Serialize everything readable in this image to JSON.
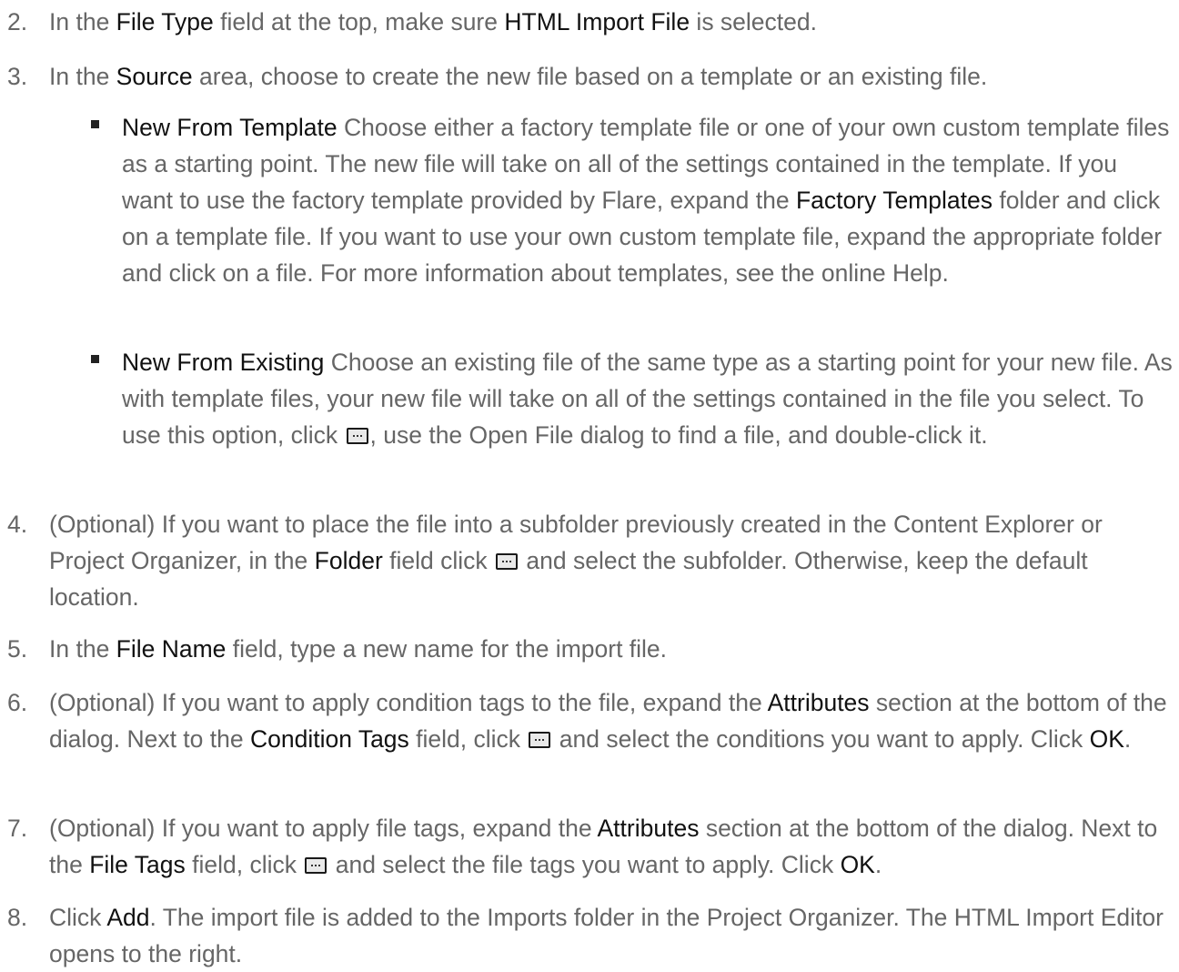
{
  "steps": {
    "s2": {
      "num": "2.",
      "t1": "In the ",
      "k1": "File Type",
      "t2": " field at the top, make sure ",
      "k2": "HTML Import File",
      "t3": " is selected."
    },
    "s3": {
      "num": "3.",
      "t1": "In the ",
      "k1": "Source",
      "t2": " area, choose to create the new file based on a template or an existing file."
    },
    "b1": {
      "k1": "New From Template",
      "t1": " Choose either a factory template file or one of your own custom template files as a starting point. The new file will take on all of the settings contained in the template. If you want to use the factory template provided by Flare, expand the ",
      "k2": "Factory Templates",
      "t2": " folder and click on a template file. If you want to use your own custom template file, expand the appropriate folder and click on a file. For more information about templates, see the online Help."
    },
    "b2": {
      "k1": "New From Existing",
      "t1": " Choose an existing file of the same type as a starting point for your new file. As with template files, your new file will take on all of the settings contained in the file you select. To use this option, click ",
      "t2": ", use the Open File dialog to find a file, and double-click it."
    },
    "s4": {
      "num": "4.",
      "t1": "(Optional) If you want to place the file into a subfolder previously created in the Content Explorer or Project Organizer, in the ",
      "k1": "Folder",
      "t2": " field click ",
      "t3": " and select the subfolder. Otherwise, keep the default location."
    },
    "s5": {
      "num": "5.",
      "t1": "In the ",
      "k1": "File Name",
      "t2": " field, type a new name for the import file."
    },
    "s6": {
      "num": "6.",
      "t1": "(Optional) If you want to apply condition tags to the file, expand the ",
      "k1": "Attributes",
      "t2": " section at the bottom of the dialog. Next to the ",
      "k2": "Condition Tags",
      "t3": " field, click ",
      "t4": " and select the conditions you want to apply. Click ",
      "k3": "OK",
      "t5": "."
    },
    "s7": {
      "num": "7.",
      "t1": "(Optional) If you want to apply file tags, expand the ",
      "k1": "Attributes",
      "t2": " section at the bottom of the dialog. Next to the ",
      "k2": "File Tags",
      "t3": " field, click ",
      "t4": " and select the file tags you want to apply. Click ",
      "k3": "OK",
      "t5": "."
    },
    "s8": {
      "num": "8.",
      "t1": "Click ",
      "k1": "Add",
      "t2": ". The import file is added to the Imports folder in the Project Organizer. The HTML Import Editor opens to the right."
    }
  },
  "icons": {
    "browse": "ellipsis-browse-icon"
  }
}
